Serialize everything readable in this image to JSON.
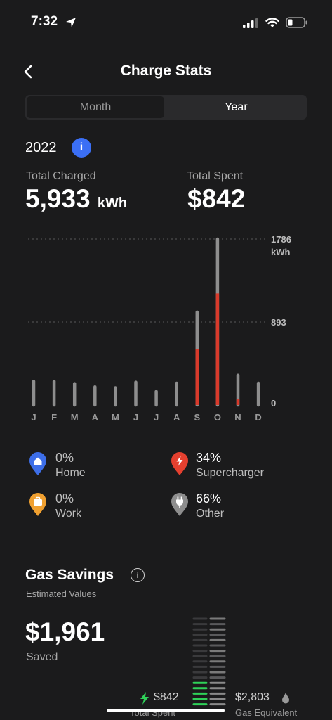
{
  "status_bar": {
    "time": "7:32"
  },
  "header": {
    "title": "Charge Stats"
  },
  "segments": {
    "month": "Month",
    "year": "Year"
  },
  "period": {
    "year": "2022",
    "info_glyph": "i"
  },
  "totals": {
    "charged_label": "Total Charged",
    "charged_value": "5,933",
    "charged_unit": "kWh",
    "spent_label": "Total Spent",
    "spent_value": "$842"
  },
  "chart_data": {
    "type": "bar",
    "categories": [
      "J",
      "F",
      "M",
      "A",
      "M",
      "J",
      "J",
      "A",
      "S",
      "O",
      "N",
      "D"
    ],
    "series": [
      {
        "values": [
          255,
          255,
          230,
          195,
          185,
          245,
          145,
          235,
          1000,
          1786,
          320,
          235
        ]
      },
      {
        "values": [
          0,
          0,
          0,
          0,
          0,
          0,
          0,
          0,
          600,
          1200,
          60,
          0
        ]
      }
    ],
    "ylim": [
      0,
      1786
    ],
    "ytick_labels": [
      "1786",
      "kWh",
      "893",
      "0"
    ],
    "grid": true,
    "colors": {
      "total": "#8e8e8e",
      "supercharger": "#d93a2b",
      "gridline": "#5a5a5a"
    }
  },
  "legend": {
    "home": {
      "pct": "0%",
      "name": "Home",
      "color": "#3d6ee8"
    },
    "supercharger": {
      "pct": "34%",
      "name": "Supercharger",
      "color": "#e5402f"
    },
    "work": {
      "pct": "0%",
      "name": "Work",
      "color": "#f0a030"
    },
    "other": {
      "pct": "66%",
      "name": "Other",
      "color": "#8e8e8e"
    }
  },
  "gas_savings": {
    "title": "Gas Savings",
    "info_glyph": "i",
    "subtitle": "Estimated Values",
    "saved_value": "$1,961",
    "saved_label": "Saved",
    "total_spent_value": "$842",
    "total_spent_label": "Total Spent",
    "gas_equivalent_value": "$2,803",
    "gas_equivalent_label": "Gas Equivalent"
  }
}
